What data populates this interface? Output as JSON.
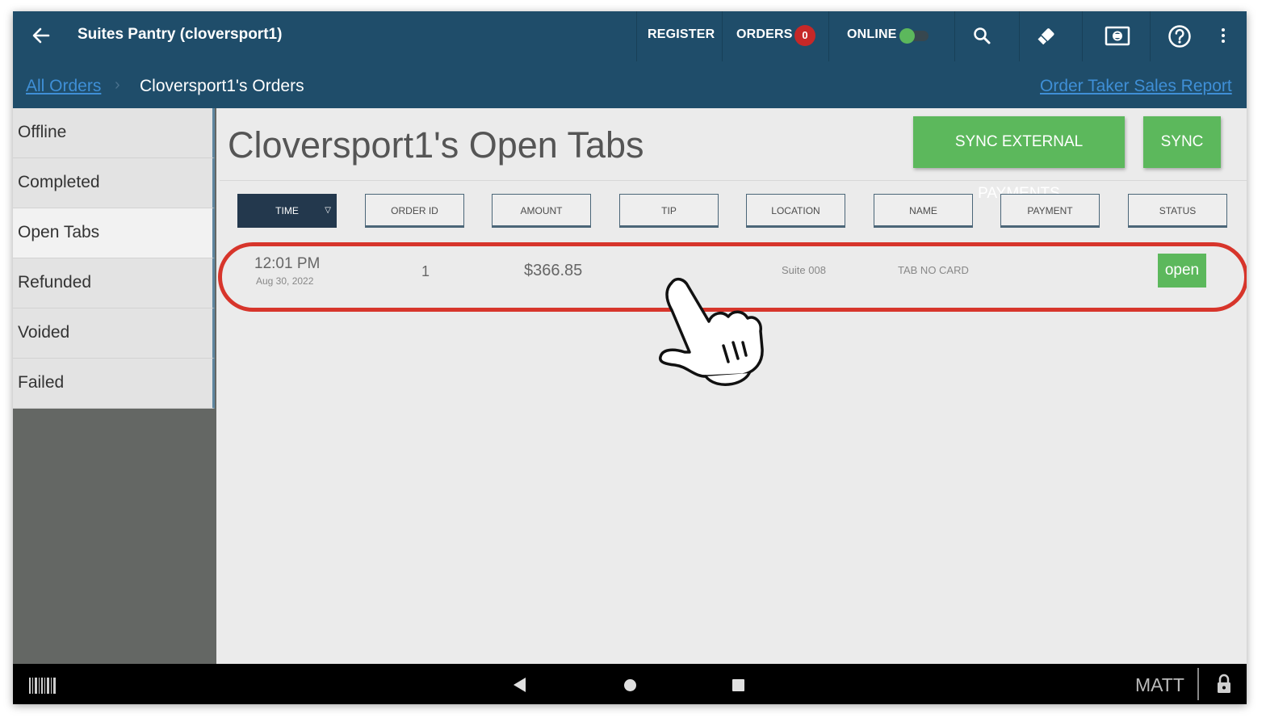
{
  "topbar": {
    "title": "Suites Pantry (cloversport1)",
    "register_label": "REGISTER",
    "orders_label": "ORDERS",
    "orders_count": "0",
    "online_label": "ONLINE",
    "online_enabled": true
  },
  "breadcrumb": {
    "all_orders": "All Orders",
    "current": "Cloversport1's Orders",
    "report_link": "Order Taker Sales Report"
  },
  "sidebar": {
    "items": [
      {
        "label": "Offline"
      },
      {
        "label": "Completed"
      },
      {
        "label": "Open Tabs",
        "active": true
      },
      {
        "label": "Refunded"
      },
      {
        "label": "Voided"
      },
      {
        "label": "Failed"
      }
    ]
  },
  "main": {
    "title": "Cloversport1's Open Tabs",
    "sync_external_label": "SYNC EXTERNAL PAYMENTS",
    "sync_label": "SYNC",
    "columns": [
      "TIME",
      "ORDER ID",
      "AMOUNT",
      "TIP",
      "LOCATION",
      "NAME",
      "PAYMENT",
      "STATUS"
    ],
    "sorted_column": "TIME",
    "orders": [
      {
        "time": "12:01 PM",
        "date": "Aug 30, 2022",
        "order_id": "1",
        "amount": "$366.85",
        "tip": "",
        "location": "Suite 008",
        "name": "TAB NO CARD",
        "payment": "",
        "status": "open"
      }
    ]
  },
  "bottom_nav": {
    "user": "MATT"
  },
  "colors": {
    "header_bg": "#1f4d6a",
    "accent_green": "#5cb85c",
    "highlight_red": "#d7352b",
    "link_blue": "#3f8fd6"
  },
  "icons": [
    "back-arrow-icon",
    "search-icon",
    "eraser-icon",
    "cash-drawer-icon",
    "help-icon",
    "more-vert-icon",
    "barcode-icon",
    "lock-icon",
    "pointing-hand-icon"
  ]
}
